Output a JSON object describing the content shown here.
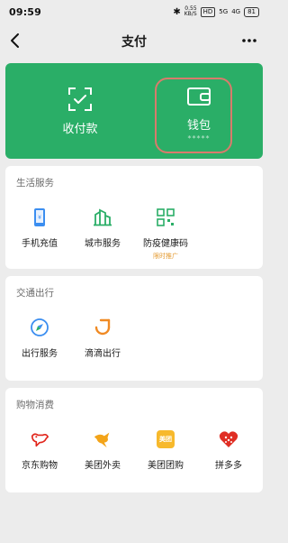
{
  "status": {
    "time": "09:59",
    "speed_value": "0.55",
    "speed_unit": "KB/S",
    "hd": "HD",
    "net1": "5G",
    "net2": "4G",
    "battery": "81"
  },
  "nav": {
    "title": "支付"
  },
  "hero": {
    "pay_label": "收付款",
    "wallet_label": "钱包",
    "wallet_balance": "*****"
  },
  "life": {
    "title": "生活服务",
    "items": [
      {
        "label": "手机充值"
      },
      {
        "label": "城市服务"
      },
      {
        "label": "防疫健康码",
        "tag": "限时推广"
      }
    ]
  },
  "travel": {
    "title": "交通出行",
    "items": [
      {
        "label": "出行服务"
      },
      {
        "label": "滴滴出行"
      }
    ]
  },
  "shop": {
    "title": "购物消费",
    "items": [
      {
        "label": "京东购物"
      },
      {
        "label": "美团外卖"
      },
      {
        "label": "美团团购",
        "badge": "美团"
      },
      {
        "label": "拼多多"
      }
    ]
  },
  "colors": {
    "green": "#2aae67",
    "highlight": "#d97b6c",
    "tag": "#e49b32"
  }
}
